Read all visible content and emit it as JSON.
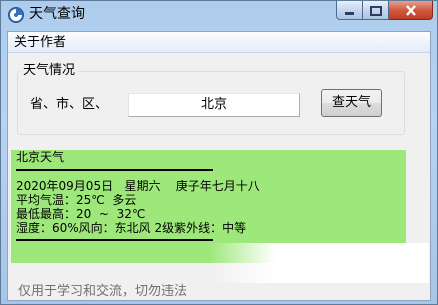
{
  "window": {
    "title": "天气查询"
  },
  "menu": {
    "items": [
      "关于作者"
    ]
  },
  "location_group": {
    "title": "天气情况",
    "label": "省、市、区、",
    "input_value": "北京",
    "button_label": "查天气"
  },
  "result": {
    "heading": "北京天气",
    "date_line": "2020年09月05日   星期六    庚子年七月十八",
    "temp_line": "平均气温：25℃  多云",
    "range_line": "最低最高：20  ~  32℃",
    "humidity_line": "湿度：60%风向：东北风 2级紫外线：中等"
  },
  "footer": {
    "text": "仅用于学习和交流，切勿违法"
  },
  "colors": {
    "result_background": "#9ee87b",
    "title_gradient": "#b6d3f2",
    "close_button": "#c03e22"
  },
  "icons": [
    "app-icon",
    "minimize-icon",
    "maximize-icon",
    "close-icon"
  ]
}
